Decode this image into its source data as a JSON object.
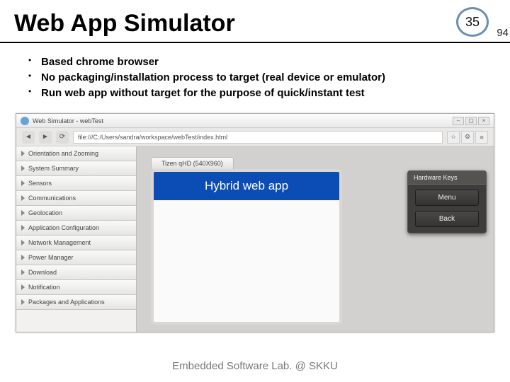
{
  "slide": {
    "title": "Web App Simulator",
    "page_number": "35",
    "sub_number": "94",
    "bullets": [
      "Based chrome browser",
      "No packaging/installation process to target (real device or emulator)",
      "Run web app without target for the purpose of quick/instant test"
    ],
    "footer": "Embedded Software Lab. @ SKKU"
  },
  "simulator": {
    "window_title": "Web Simulator - webTest",
    "url": "file:///C:/Users/sandra/workspace/webTest/index.html",
    "accordion": [
      "Orientation and Zooming",
      "System Summary",
      "Sensors",
      "Communications",
      "Geolocation",
      "Application Configuration",
      "Network Management",
      "Power Manager",
      "Download",
      "Notification",
      "Packages and Applications"
    ],
    "device_tab": "Tizen qHD (540X960)",
    "app_header": "Hybrid web app",
    "hw_panel": {
      "title": "Hardware Keys",
      "menu": "Menu",
      "back": "Back"
    }
  }
}
